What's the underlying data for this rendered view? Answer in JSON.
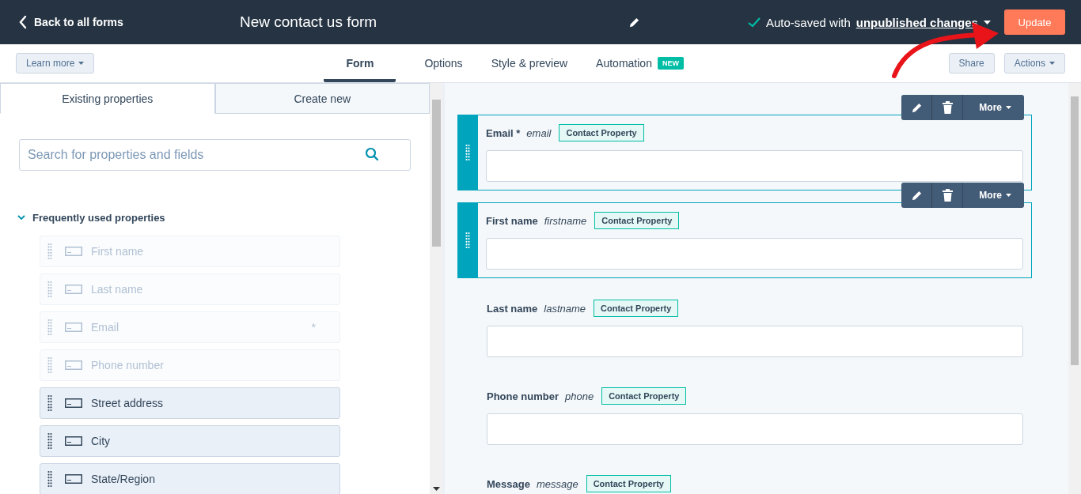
{
  "header": {
    "back_link": "Back to all forms",
    "title": "New contact us form",
    "save_status": "Auto-saved with",
    "save_status_link": "unpublished changes",
    "update_button": "Update"
  },
  "toolbar": {
    "learn_more": "Learn more",
    "tabs": [
      {
        "label": "Form",
        "selected": true
      },
      {
        "label": "Options",
        "selected": false
      },
      {
        "label": "Style & preview",
        "selected": false
      },
      {
        "label": "Automation",
        "selected": false,
        "badge": "NEW"
      }
    ],
    "share": "Share",
    "actions": "Actions"
  },
  "left_panel": {
    "tabs": [
      {
        "label": "Existing properties",
        "selected": true
      },
      {
        "label": "Create new",
        "selected": false
      }
    ],
    "search": {
      "placeholder": "Search for properties and fields"
    },
    "group": {
      "label": "Frequently used properties",
      "expanded": true,
      "items": [
        {
          "label": "First name",
          "disabled": true
        },
        {
          "label": "Last name",
          "disabled": true
        },
        {
          "label": "Email",
          "disabled": true,
          "mark": "*"
        },
        {
          "label": "Phone number",
          "disabled": true
        },
        {
          "label": "Street address",
          "disabled": false
        },
        {
          "label": "City",
          "disabled": false
        },
        {
          "label": "State/Region",
          "disabled": false
        }
      ]
    }
  },
  "form_fields": [
    {
      "label": "Email *",
      "property": "email",
      "tag": "Contact Property",
      "selected": true,
      "more_button": "More"
    },
    {
      "label": "First name",
      "property": "firstname",
      "tag": "Contact Property",
      "selected": true,
      "more_button": "More"
    },
    {
      "label": "Last name",
      "property": "lastname",
      "tag": "Contact Property",
      "selected": false
    },
    {
      "label": "Phone number",
      "property": "phone",
      "tag": "Contact Property",
      "selected": false
    },
    {
      "label": "Message",
      "property": "message",
      "tag": "Contact Property",
      "selected": false
    }
  ]
}
